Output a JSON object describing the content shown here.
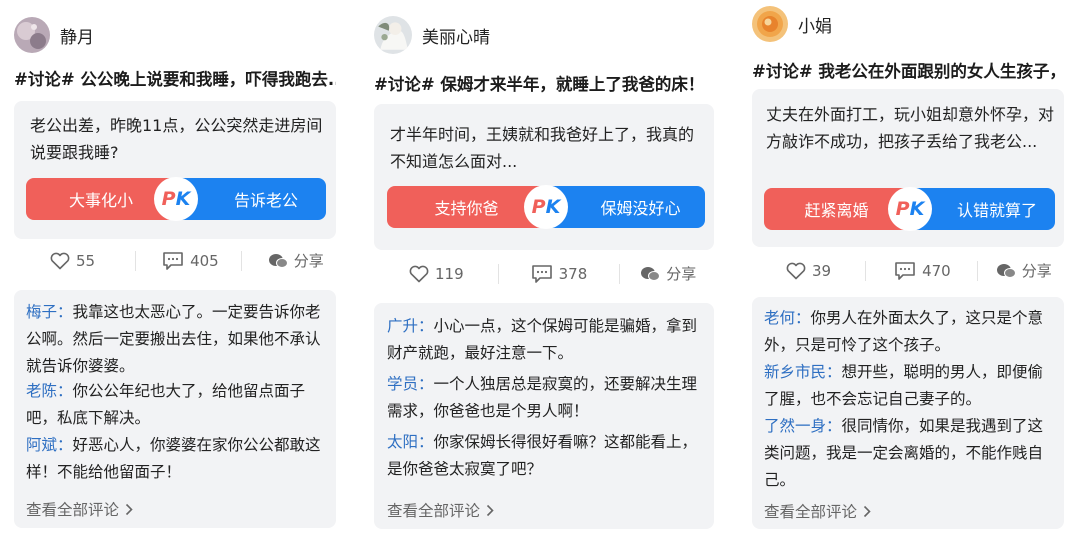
{
  "posts": [
    {
      "username": "静月",
      "title": "#讨论# 公公晚上说要和我睡，吓得我跑去...",
      "text": "老公出差，昨晚11点，公公突然走进房间说要跟我睡?",
      "pk_left": "大事化小",
      "pk_right": "告诉老公",
      "pk_badge_p": "P",
      "pk_badge_k": "K",
      "likes": "55",
      "comments_count": "405",
      "share": "分享",
      "comments": [
        {
          "who": "梅子：",
          "text": "我靠这也太恶心了。一定要告诉你老公啊。然后一定要搬出去住，如果他不承认就告诉你婆婆。"
        },
        {
          "who": "老陈：",
          "text": "你公公年纪也大了，给他留点面子吧，私底下解决。"
        },
        {
          "who": "阿斌：",
          "text": "好恶心人，你婆婆在家你公公都敢这样！不能给他留面子！"
        }
      ],
      "view_all": "查看全部评论"
    },
    {
      "username": "美丽心晴",
      "title": "#讨论# 保姆才来半年，就睡上了我爸的床！",
      "text": "才半年时间，王姨就和我爸好上了，我真的不知道怎么面对...",
      "pk_left": "支持你爸",
      "pk_right": "保姆没好心",
      "pk_badge_p": "P",
      "pk_badge_k": "K",
      "likes": "119",
      "comments_count": "378",
      "share": "分享",
      "comments": [
        {
          "who": "广升：",
          "text": "小心一点，这个保姆可能是骗婚，拿到财产就跑，最好注意一下。"
        },
        {
          "who": "学员：",
          "text": "一个人独居总是寂寞的，还要解决生理需求，你爸爸也是个男人啊！"
        },
        {
          "who": "太阳：",
          "text": "你家保姆长得很好看嘛？这都能看上，是你爸爸太寂寞了吧？"
        }
      ],
      "view_all": "查看全部评论"
    },
    {
      "username": "小娟",
      "title": "#讨论# 我老公在外面跟别的女人生孩子，...",
      "text": "丈夫在外面打工，玩小姐却意外怀孕，对方敲诈不成功，把孩子丢给了我老公...",
      "pk_left": "赶紧离婚",
      "pk_right": "认错就算了",
      "pk_badge_p": "P",
      "pk_badge_k": "K",
      "likes": "39",
      "comments_count": "470",
      "share": "分享",
      "comments": [
        {
          "who": "老何：",
          "text": "你男人在外面太久了，这只是个意外，只是可怜了这个孩子。"
        },
        {
          "who": "新乡市民：",
          "text": "想开些，聪明的男人，即便偷了腥，也不会忘记自己妻子的。"
        },
        {
          "who": "了然一身：",
          "text": "很同情你，如果是我遇到了这类问题，我是一定会离婚的，不能作贱自己。"
        }
      ],
      "view_all": "查看全部评论"
    }
  ],
  "colors": {
    "pk_red": "#f0605a",
    "pk_blue": "#1c82f0",
    "commenter": "#2e6fc2",
    "panel": "#f2f3f5"
  },
  "icons": {
    "like": "heart-icon",
    "comment": "comment-icon",
    "share": "share-icon",
    "more": "chevron-right-icon"
  }
}
